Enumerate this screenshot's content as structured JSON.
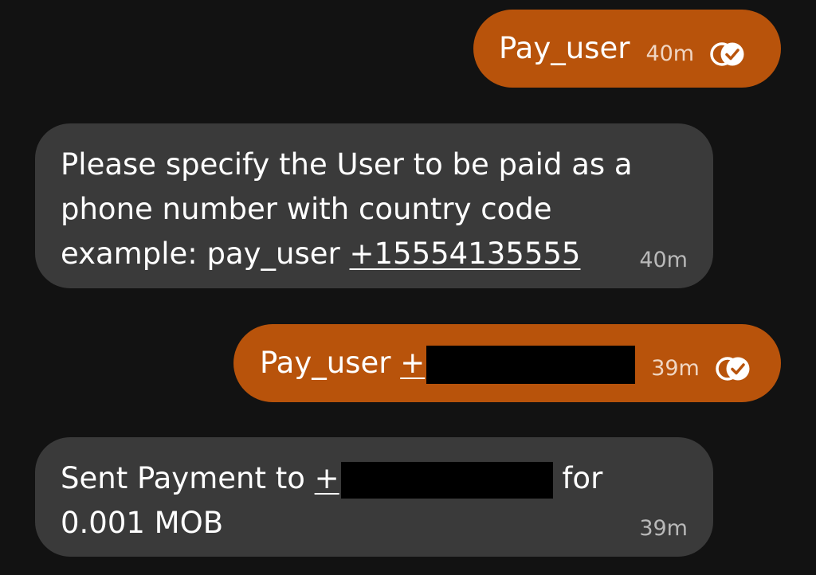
{
  "messages": [
    {
      "direction": "outgoing",
      "text": "Pay_user",
      "time": "40m",
      "receipt_icon": "read-receipt-icon"
    },
    {
      "direction": "incoming",
      "lines": [
        "Please specify the User to be paid as a",
        "phone number with country code",
        "example: pay_user "
      ],
      "phone_link": "+15554135555",
      "time": "40m"
    },
    {
      "direction": "outgoing",
      "text": "Pay_user ",
      "link_prefix": "+",
      "time": "39m",
      "receipt_icon": "read-receipt-icon"
    },
    {
      "direction": "incoming",
      "prefix": "Sent Payment to ",
      "link_prefix": "+",
      "suffix": " for",
      "line2": "0.001 MOB",
      "time": "39m"
    }
  ],
  "colors": {
    "background": "#121212",
    "outgoing_bubble": "#b8530b",
    "incoming_bubble": "#3a3a3a",
    "redaction": "#000000"
  }
}
